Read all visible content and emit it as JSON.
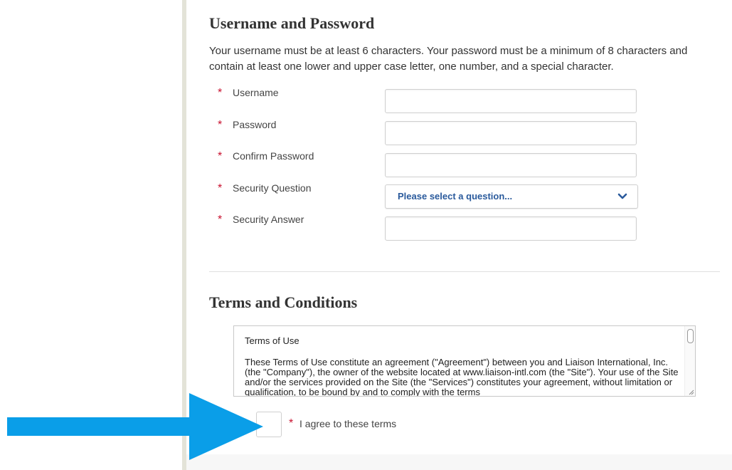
{
  "credentials": {
    "title": "Username and Password",
    "intro": "Your username must be at least 6 characters. Your password must be a minimum of 8 characters and contain at least one lower and upper case letter, one number, and a special character.",
    "required_marker": "*",
    "fields": [
      {
        "label": "Username",
        "value": ""
      },
      {
        "label": "Password",
        "value": ""
      },
      {
        "label": "Confirm Password",
        "value": ""
      },
      {
        "label": "Security Question",
        "selected": "Please select a question..."
      },
      {
        "label": "Security Answer",
        "value": ""
      }
    ]
  },
  "terms": {
    "title": "Terms and Conditions",
    "heading": "Terms of Use",
    "body": "These Terms of Use constitute an agreement (\"Agreement\") between you and Liaison International, Inc. (the \"Company\"), the owner of the website located at www.liaison-intl.com (the \"Site\"). Your use of the Site and/or the services provided on the Site (the \"Services\") constitutes your agreement, without limitation or qualification, to be bound by and to comply with the terms",
    "agree_label": "I agree to these terms",
    "agree_checked": false
  },
  "colors": {
    "required_star": "#c8102e",
    "select_text": "#2a5a9c",
    "pointer_arrow": "#0a9ee8"
  },
  "icons": {
    "select_chevron": "chevron-down-icon",
    "annotation_arrow": "arrow-right-icon"
  }
}
